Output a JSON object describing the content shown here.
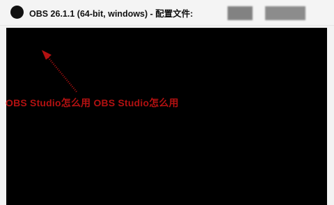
{
  "window": {
    "title": "OBS 26.1.1 (64-bit, windows) - 配置文件:"
  },
  "annotation": {
    "text": "OBS Studio怎么用 OBS Studio怎么用",
    "color": "#b31111"
  },
  "colors": {
    "client_background": "#000000",
    "titlebar_background": "#f4f4f4"
  },
  "icons": {
    "app": "obs-logo-icon",
    "pointer": "red-arrow-icon"
  }
}
